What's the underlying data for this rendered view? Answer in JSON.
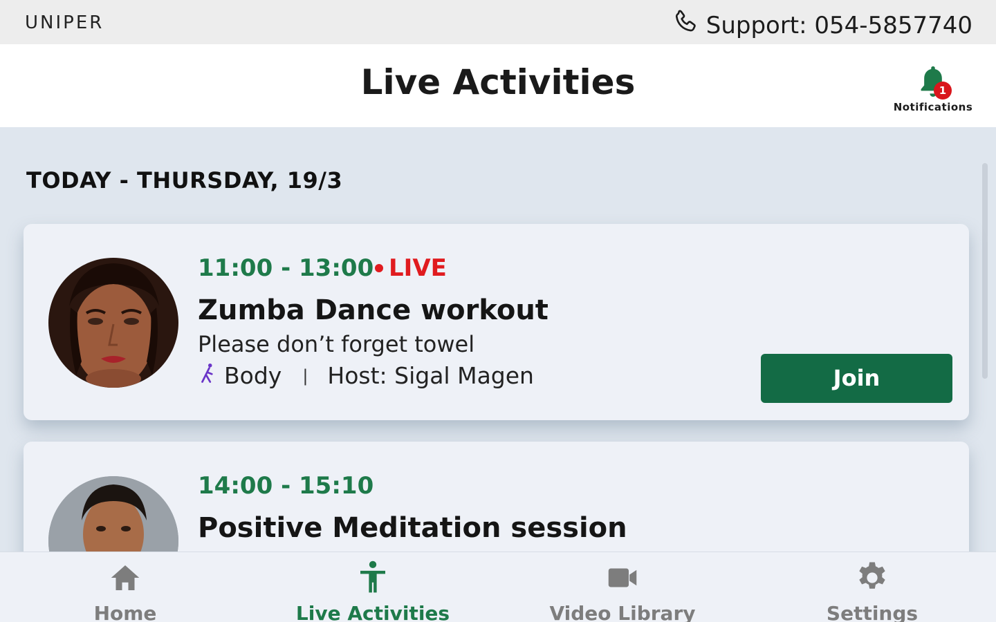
{
  "brand": "UNIPER",
  "support": {
    "text": "Support: 054-5857740",
    "icon": "phone-icon"
  },
  "header": {
    "title": "Live Activities"
  },
  "notifications": {
    "label": "Notifications",
    "count": "1",
    "icon": "bell-icon"
  },
  "date_heading": "TODAY - THURSDAY, 19/3",
  "activities": [
    {
      "time": "11:00 - 13:00",
      "live_label": "LIVE",
      "title": "Zumba Dance workout",
      "description": "Please don’t forget towel",
      "category": "Body",
      "category_icon": "runner-icon",
      "separator": "|",
      "host": "Host: Sigal Magen",
      "join_label": "Join"
    },
    {
      "time": "14:00 - 15:10",
      "title": "Positive Meditation session"
    }
  ],
  "nav": [
    {
      "label": "Home",
      "icon": "home-icon"
    },
    {
      "label": "Live Activities",
      "icon": "person-activity-icon"
    },
    {
      "label": "Video Library",
      "icon": "video-camera-icon"
    },
    {
      "label": "Settings",
      "icon": "gear-icon"
    }
  ],
  "colors": {
    "accent_green": "#1e7a4a",
    "join_button": "#136b45",
    "live_red": "#e01b1f",
    "badge_red": "#d9161c",
    "inactive_nav": "#7d7d7d"
  }
}
